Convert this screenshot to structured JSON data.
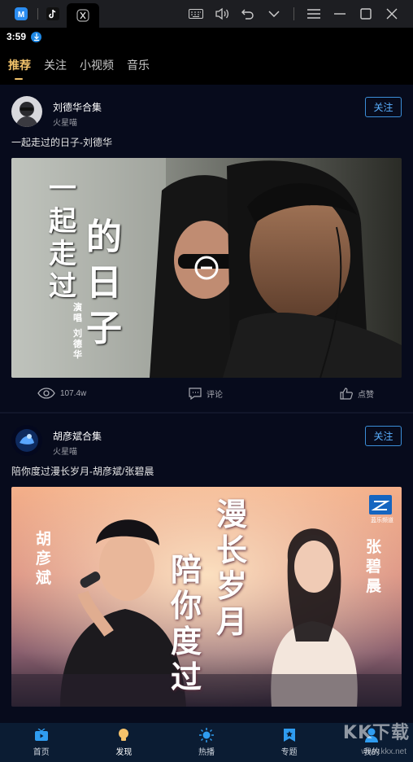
{
  "status": {
    "time": "3:59"
  },
  "topnav": {
    "tabs": [
      "推荐",
      "关注",
      "小视频",
      "音乐"
    ]
  },
  "posts": [
    {
      "author": "刘德华合集",
      "source": "火星喵",
      "follow_label": "关注",
      "description": "一起走过的日子-刘德华",
      "cover_text": {
        "title_a": "一起走过",
        "title_b": "的日子",
        "singer_label": "演唱",
        "singer": "刘德华"
      },
      "views": "107.4w",
      "comment_label": "评论",
      "like_label": "点赞"
    },
    {
      "author": "胡彦斌合集",
      "source": "火星喵",
      "follow_label": "关注",
      "description": "陪你度过漫长岁月-胡彦斌/张碧晨",
      "cover_text": {
        "left_name": "胡彦斌",
        "right_name": "张碧晨",
        "title_a": "陪你度过",
        "title_b": "漫长岁月",
        "badge": "蓝乐频道"
      }
    }
  ],
  "bottomnav": {
    "items": [
      "首页",
      "发现",
      "热播",
      "专题",
      "我的"
    ],
    "active_index": 1
  },
  "watermark": {
    "main": "KK下载",
    "sub": "www.kkx.net"
  },
  "colors": {
    "accent": "#f2c36b",
    "follow": "#5ab0ff",
    "background": "#070b1c",
    "bottom_nav": "#0b1c33"
  }
}
